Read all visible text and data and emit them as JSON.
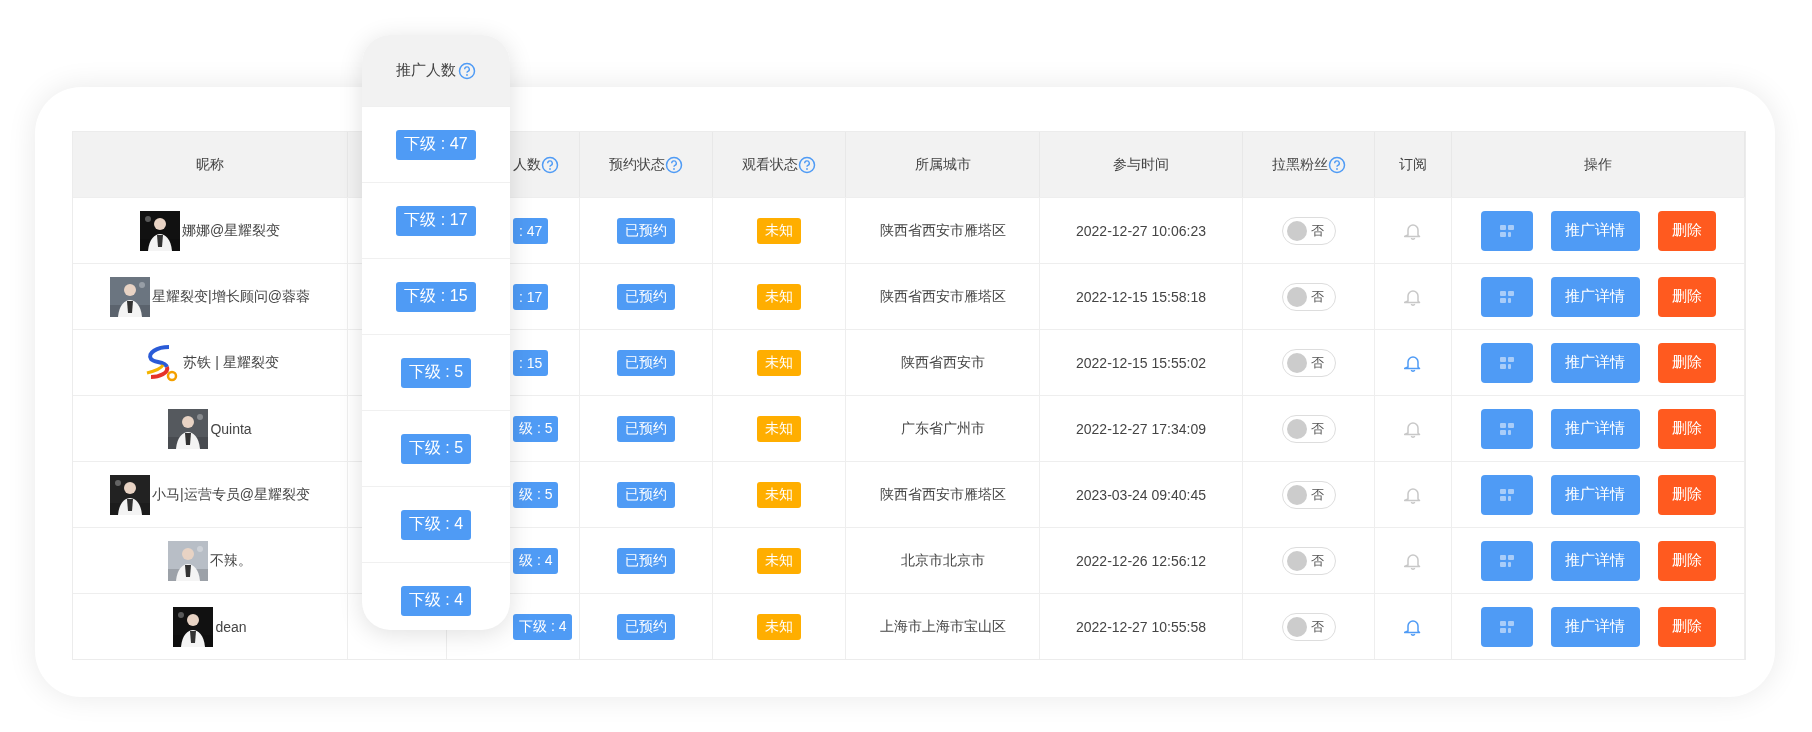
{
  "overlay_column": {
    "header": "推广人数",
    "help": true,
    "rows": [
      "下级 : 47",
      "下级 : 17",
      "下级 : 15",
      "下级 : 5",
      "下级 : 5",
      "下级 : 4",
      "下级 : 4"
    ]
  },
  "table": {
    "columns": [
      {
        "label": "昵称",
        "help": false
      },
      {
        "kind": "covered"
      },
      {
        "label": "人数",
        "help": true
      },
      {
        "label": "预约状态",
        "help": true
      },
      {
        "label": "观看状态",
        "help": true
      },
      {
        "label": "所属城市",
        "help": false
      },
      {
        "label": "参与时间",
        "help": false
      },
      {
        "label": "拉黑粉丝",
        "help": true
      },
      {
        "label": "订阅",
        "help": false
      },
      {
        "label": "操作",
        "help": false
      }
    ],
    "rows": [
      {
        "nickname": "娜娜@星耀裂变",
        "count": ": 47",
        "booking": "已预约",
        "watch": "未知",
        "city": "陕西省西安市雁塔区",
        "time": "2022-12-27 10:06:23",
        "blacklist": {
          "label": "否",
          "on": false
        },
        "subscribed": false,
        "actions": [
          "推广详情",
          "删除"
        ]
      },
      {
        "nickname": "星耀裂变|增长顾问@蓉蓉",
        "count": ": 17",
        "booking": "已预约",
        "watch": "未知",
        "city": "陕西省西安市雁塔区",
        "time": "2022-12-15 15:58:18",
        "blacklist": {
          "label": "否",
          "on": false
        },
        "subscribed": false,
        "actions": [
          "推广详情",
          "删除"
        ]
      },
      {
        "avatar": {
          "kind": "logo"
        },
        "nickname": "苏铁 | 星耀裂变",
        "count": ": 15",
        "booking": "已预约",
        "watch": "未知",
        "city": "陕西省西安市",
        "time": "2022-12-15 15:55:02",
        "blacklist": {
          "label": "否",
          "on": false
        },
        "subscribed": true,
        "actions": [
          "推广详情",
          "删除"
        ]
      },
      {
        "nickname": "Quinta",
        "count": "级 : 5",
        "booking": "已预约",
        "watch": "未知",
        "city": "广东省广州市",
        "time": "2022-12-27 17:34:09",
        "blacklist": {
          "label": "否",
          "on": false
        },
        "subscribed": false,
        "actions": [
          "推广详情",
          "删除"
        ]
      },
      {
        "nickname": "小马|运营专员@星耀裂变",
        "count": "级 : 5",
        "booking": "已预约",
        "watch": "未知",
        "city": "陕西省西安市雁塔区",
        "time": "2023-03-24 09:40:45",
        "blacklist": {
          "label": "否",
          "on": false
        },
        "subscribed": false,
        "actions": [
          "推广详情",
          "删除"
        ]
      },
      {
        "nickname": "不辣。",
        "count": "级 : 4",
        "booking": "已预约",
        "watch": "未知",
        "city": "北京市北京市",
        "time": "2022-12-26 12:56:12",
        "blacklist": {
          "label": "否",
          "on": false
        },
        "subscribed": false,
        "actions": [
          "推广详情",
          "删除"
        ]
      },
      {
        "nickname": "dean",
        "count": "下级 : 4",
        "booking": "已预约",
        "watch": "未知",
        "city": "上海市上海市宝山区",
        "time": "2022-12-27 10:55:58",
        "blacklist": {
          "label": "否",
          "on": false
        },
        "subscribed": true,
        "actions": [
          "推广详情",
          "删除"
        ]
      }
    ]
  }
}
